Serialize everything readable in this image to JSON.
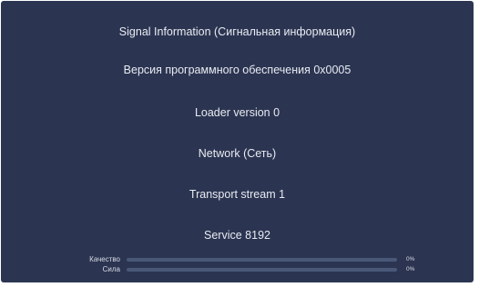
{
  "screen": {
    "title": "Signal Information (Сигнальная информация)",
    "items": [
      "Версия программного обеспечения 0x0005",
      "Loader version 0",
      "Network (Сеть)",
      "Transport stream 1",
      "Service 8192"
    ]
  },
  "meters": {
    "quality": {
      "label": "Качество",
      "value_text": "0%",
      "level": 0
    },
    "strength": {
      "label": "Сила",
      "value_text": "0%",
      "level": 0
    }
  },
  "colors": {
    "background": "#2b3552",
    "text": "#e9ebf1",
    "track": "#4a5878",
    "fill": "#8fb3ff"
  }
}
